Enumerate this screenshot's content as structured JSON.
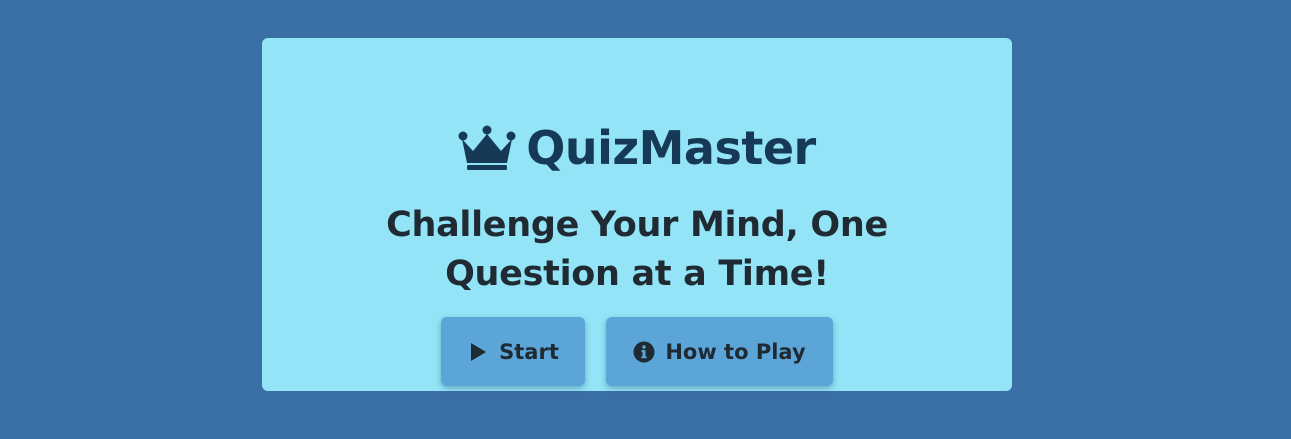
{
  "brand": {
    "title": "QuizMaster",
    "icon": "crown-icon"
  },
  "tagline": {
    "line1": "Challenge Your Mind, One",
    "line2": "Question at a Time!"
  },
  "buttons": {
    "start": {
      "label": "Start",
      "icon": "play-icon"
    },
    "how_to_play": {
      "label": "How to Play",
      "icon": "info-circle-icon"
    }
  },
  "colors": {
    "background": "#3a6fa5",
    "card": "#93e4f7",
    "brand_text": "#163a55",
    "text": "#1f2a33",
    "button": "#5ba5d8"
  }
}
